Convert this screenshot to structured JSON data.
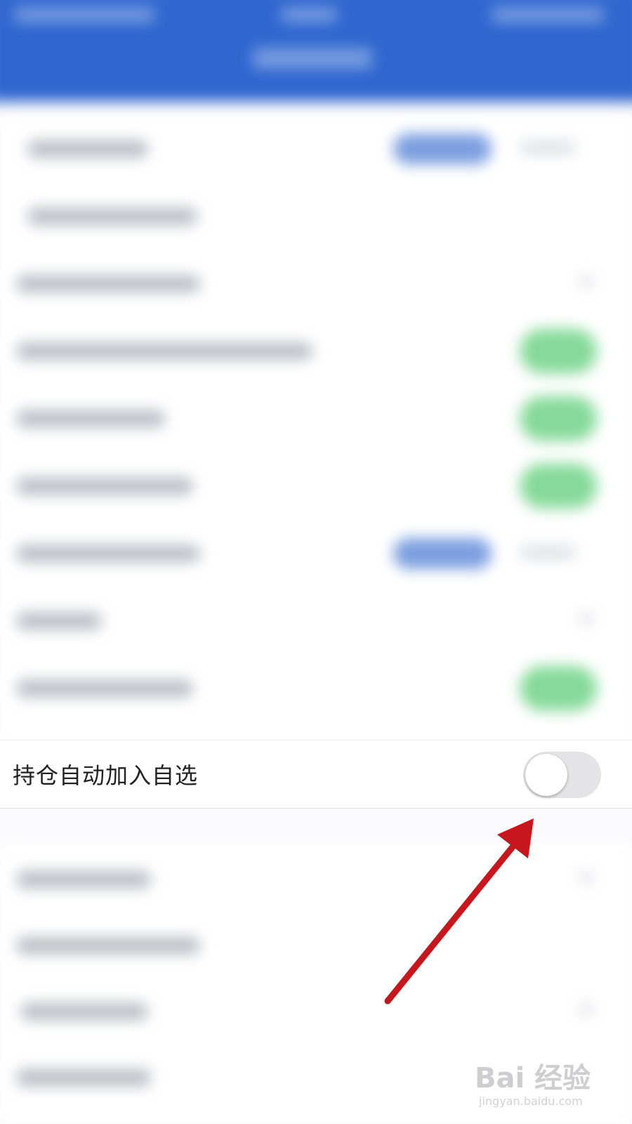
{
  "setting": {
    "label": "持仓自动加入自选",
    "toggle_state": "off"
  },
  "colors": {
    "header_blue": "#2f66cf",
    "toggle_on_green": "#86d99a",
    "toggle_off_gray": "#e4e4e7",
    "annotation_red": "#c8161d"
  },
  "watermark": {
    "logo_text": "Bai 经验",
    "url_text": "jingyan.baidu.com"
  }
}
